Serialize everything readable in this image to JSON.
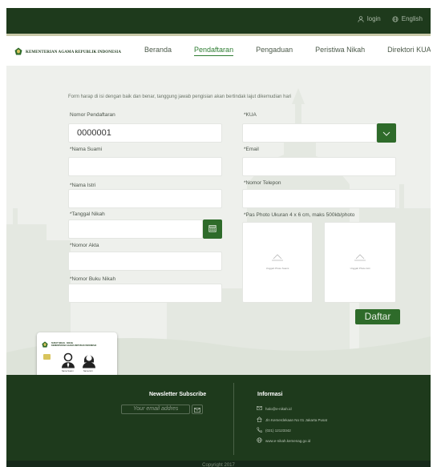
{
  "topbar": {
    "login_label": "login",
    "language_label": "English"
  },
  "nav": {
    "brand": "KEMENTERIAN AGAMA REPUBLIK INDONESIA",
    "items": [
      {
        "label": "Beranda"
      },
      {
        "label": "Pendaftaran"
      },
      {
        "label": "Pengaduan"
      },
      {
        "label": "Peristiwa Nikah"
      },
      {
        "label": "Direktori KUA"
      }
    ],
    "active_index": 1
  },
  "form": {
    "intro": "Form harap di isi dengan baik dan benar, tanggung jawab pengisian akan bertindak lajut dikemudian hari",
    "nomor_pendaftaran_label": "Nomor Pendaftaran",
    "nomor_pendaftaran_value": "0000001",
    "kua_label": "*KUA",
    "nama_suami_label": "*Nama Suami",
    "email_label": "*Email",
    "nama_istri_label": "*Nama Istri",
    "nomor_telepon_label": "*Nomor Telepon",
    "tanggal_nikah_label": "*Tanggal Nikah",
    "pas_photo_label": "*Pas Photo Ukuran 4 x 6 cm, maks 500kb/photo",
    "nomor_akta_label": "*Nomor Akta",
    "nomor_buku_nikah_label": "*Nomor Buku Nikah",
    "photo_suami_label": "Unggah Photo Suami",
    "photo_istri_label": "Unggah Photo Istri",
    "submit_label": "Daftar"
  },
  "card": {
    "title_line1": "SURAT NIKAH - NIKAH",
    "title_line2": "KEMENTERIAN AGAMA REPUBLIK INDONESIA",
    "husband_label": "Nama Suami",
    "wife_label": "Nama Istri",
    "number": "000000768492"
  },
  "footer": {
    "newsletter_title": "Newsletter Subscribe",
    "email_placeholder": "Your email addres",
    "info_title": "Informasi",
    "email": "halo@e-nikah.id",
    "address": "Jln Kemerdekaan No 01 Jakarta Pusat",
    "phone": "(021) 12123342",
    "website": "www.e-nikah.kemenag.go.id",
    "copyright": "Copyright 2017"
  },
  "colors": {
    "dark_green": "#1e3a1c",
    "accent_green": "#2e6b2a",
    "active_nav": "#2e7d32",
    "background": "#eef0ec"
  }
}
